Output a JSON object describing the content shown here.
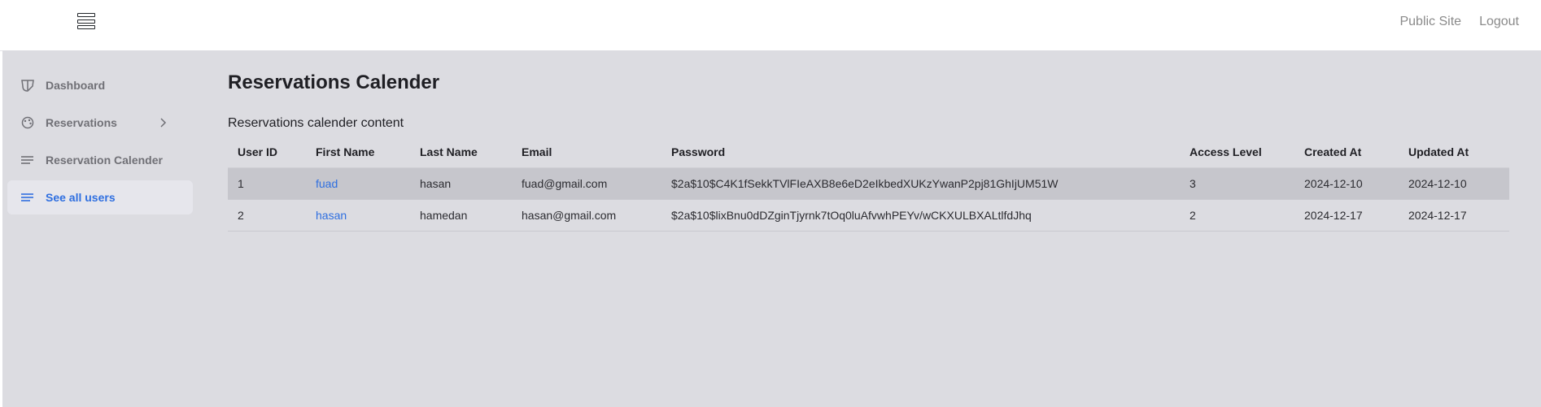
{
  "header": {
    "menu_icon": "hamburger-menu-icon",
    "links": [
      "Public Site",
      "Logout"
    ]
  },
  "sidebar": {
    "items": [
      {
        "label": "Dashboard",
        "icon": "dashboard-shield-icon"
      },
      {
        "label": "Reservations",
        "icon": "palette-icon",
        "has_chevron": true
      },
      {
        "label": "Reservation Calender",
        "icon": "lines-icon"
      },
      {
        "label": "See all users",
        "icon": "lines-icon",
        "active": true
      }
    ]
  },
  "main": {
    "title": "Reservations Calender",
    "subtitle": "Reservations calender content",
    "table": {
      "columns": [
        "User ID",
        "First Name",
        "Last Name",
        "Email",
        "Password",
        "Access Level",
        "Created At",
        "Updated At"
      ],
      "rows": [
        {
          "id": "1",
          "first_name": "fuad",
          "last_name": "hasan",
          "email": "fuad@gmail.com",
          "password": "$2a$10$C4K1fSekkTVlFIeAXB8e6eD2eIkbedXUKzYwanP2pj81GhIjUM51W",
          "access_level": "3",
          "created_at": "2024-12-10",
          "updated_at": "2024-12-10"
        },
        {
          "id": "2",
          "first_name": "hasan",
          "last_name": "hamedan",
          "email": "hasan@gmail.com",
          "password": "$2a$10$lixBnu0dDZginTjyrnk7tOq0luAfvwhPEYv/wCKXULBXALtlfdJhq",
          "access_level": "2",
          "created_at": "2024-12-17",
          "updated_at": "2024-12-17"
        }
      ]
    }
  },
  "colors": {
    "accent": "#2f6fe0",
    "background": "#dcdce1",
    "highlight_row": "#c6c6cc"
  }
}
